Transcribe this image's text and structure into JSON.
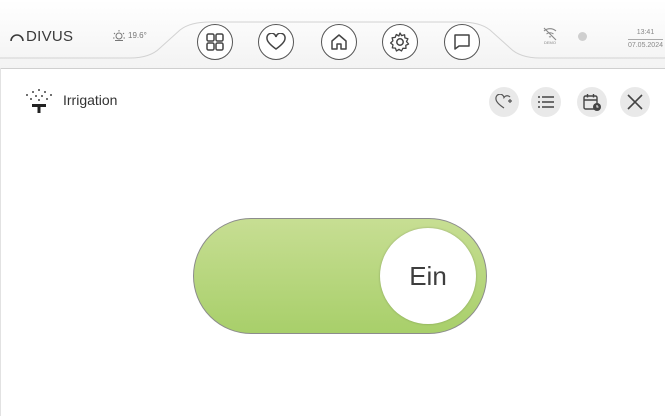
{
  "brand": {
    "name": "DIVUS"
  },
  "weather": {
    "temperature": "19.6°",
    "icon": "sun-icon"
  },
  "nav": [
    {
      "name": "apps-icon"
    },
    {
      "name": "heart-icon"
    },
    {
      "name": "home-icon"
    },
    {
      "name": "gear-icon"
    },
    {
      "name": "chat-icon"
    }
  ],
  "status": {
    "demo_label": "DEMO",
    "time": "13:41",
    "date": "07.05.2024"
  },
  "page": {
    "title": "Irrigation",
    "icon": "sprinkler-icon"
  },
  "tools": [
    {
      "name": "favorite-add-icon"
    },
    {
      "name": "list-icon"
    },
    {
      "name": "calendar-clock-icon"
    },
    {
      "name": "close-icon"
    }
  ],
  "toggle": {
    "state_label": "Ein",
    "on": true,
    "on_color": "#b6d67c"
  }
}
